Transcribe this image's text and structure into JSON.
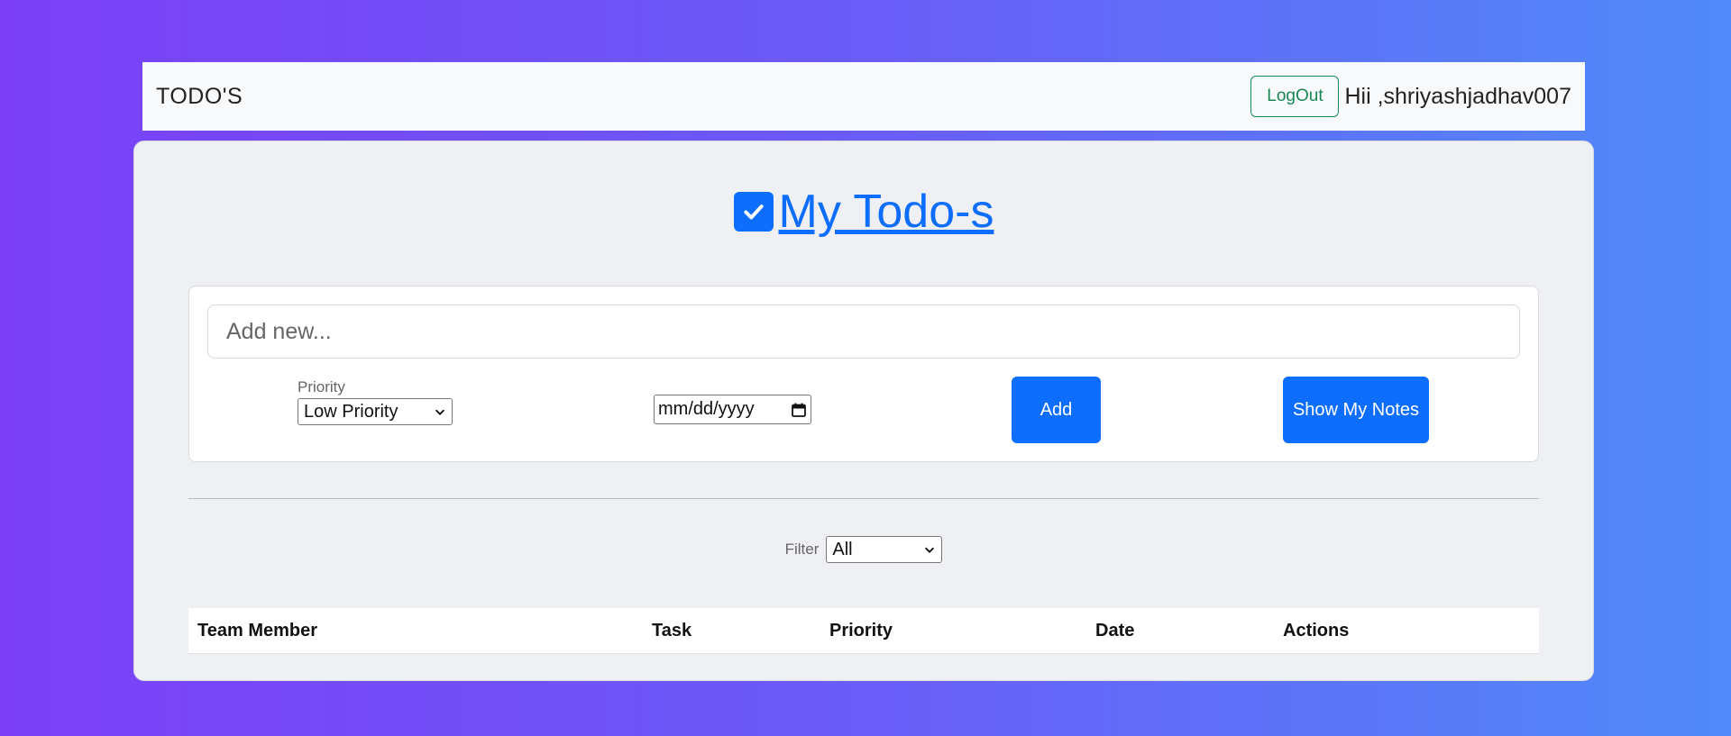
{
  "navbar": {
    "brand": "TODO'S",
    "logout_label": "LogOut",
    "greeting": "Hii ,shriyashjadhav007"
  },
  "heading": {
    "title": "My Todo-s",
    "icon": "checkbox-checked-icon"
  },
  "add_form": {
    "input_placeholder": "Add new...",
    "priority_label": "Priority",
    "priority_selected": "Low Priority",
    "date_placeholder": "mm/dd/yyyy",
    "add_label": "Add",
    "notes_label": "Show My Notes"
  },
  "filter": {
    "label": "Filter",
    "selected": "All"
  },
  "table": {
    "columns": [
      "Team Member",
      "Task",
      "Priority",
      "Date",
      "Actions"
    ]
  },
  "colors": {
    "accent": "#0d6efd",
    "success": "#198754"
  }
}
